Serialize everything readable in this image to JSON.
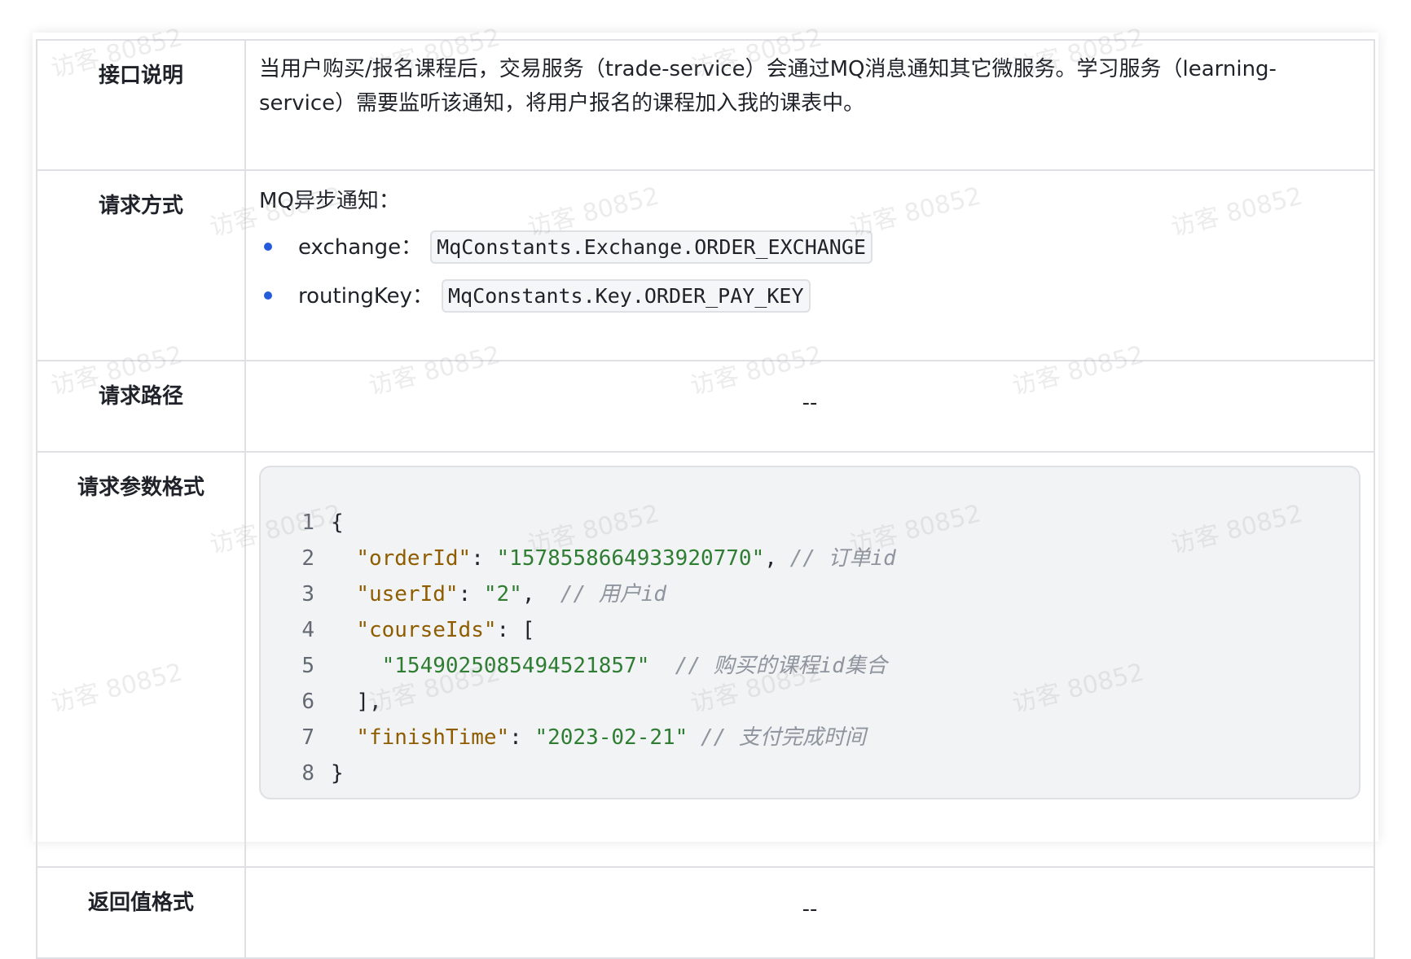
{
  "rows": {
    "desc": {
      "label": "接口说明",
      "text": "当用户购买/报名课程后，交易服务（trade-service）会通过MQ消息通知其它微服务。学习服务（learning-service）需要监听该通知，将用户报名的课程加入我的课表中。"
    },
    "method": {
      "label": "请求方式",
      "intro": "MQ异步通知：",
      "items": [
        {
          "name": "exchange：",
          "code": "MqConstants.Exchange.ORDER_EXCHANGE"
        },
        {
          "name": "routingKey：",
          "code": "MqConstants.Key.ORDER_PAY_KEY"
        }
      ]
    },
    "path": {
      "label": "请求路径",
      "value": "--"
    },
    "params": {
      "label": "请求参数格式",
      "code": [
        {
          "n": "1",
          "indent": "",
          "key": "",
          "sep": "{",
          "val": "",
          "tail": "",
          "comment": ""
        },
        {
          "n": "2",
          "indent": "  ",
          "key": "\"orderId\"",
          "sep": ": ",
          "val": "\"1578558664933920770\"",
          "tail": ", ",
          "comment": "// 订单id"
        },
        {
          "n": "3",
          "indent": "  ",
          "key": "\"userId\"",
          "sep": ": ",
          "val": "\"2\"",
          "tail": ",  ",
          "comment": "// 用户id"
        },
        {
          "n": "4",
          "indent": "  ",
          "key": "\"courseIds\"",
          "sep": ": [",
          "val": "",
          "tail": "",
          "comment": ""
        },
        {
          "n": "5",
          "indent": "    ",
          "key": "",
          "sep": "",
          "val": "\"1549025085494521857\"",
          "tail": "  ",
          "comment": "// 购买的课程id集合"
        },
        {
          "n": "6",
          "indent": "  ",
          "key": "",
          "sep": "],",
          "val": "",
          "tail": "",
          "comment": ""
        },
        {
          "n": "7",
          "indent": "  ",
          "key": "\"finishTime\"",
          "sep": ": ",
          "val": "\"2023-02-21\"",
          "tail": " ",
          "comment": "// 支付完成时间"
        },
        {
          "n": "8",
          "indent": "",
          "key": "",
          "sep": "}",
          "val": "",
          "tail": "",
          "comment": ""
        }
      ]
    },
    "return": {
      "label": "返回值格式",
      "value": "--"
    }
  },
  "watermark": "访客 80852",
  "colors": {
    "bullet": "#245bdb",
    "json_key": "#8f5d00",
    "json_string": "#2e7d32",
    "comment": "#8f959e",
    "border": "#dee0e3",
    "code_bg": "#f2f3f5"
  }
}
